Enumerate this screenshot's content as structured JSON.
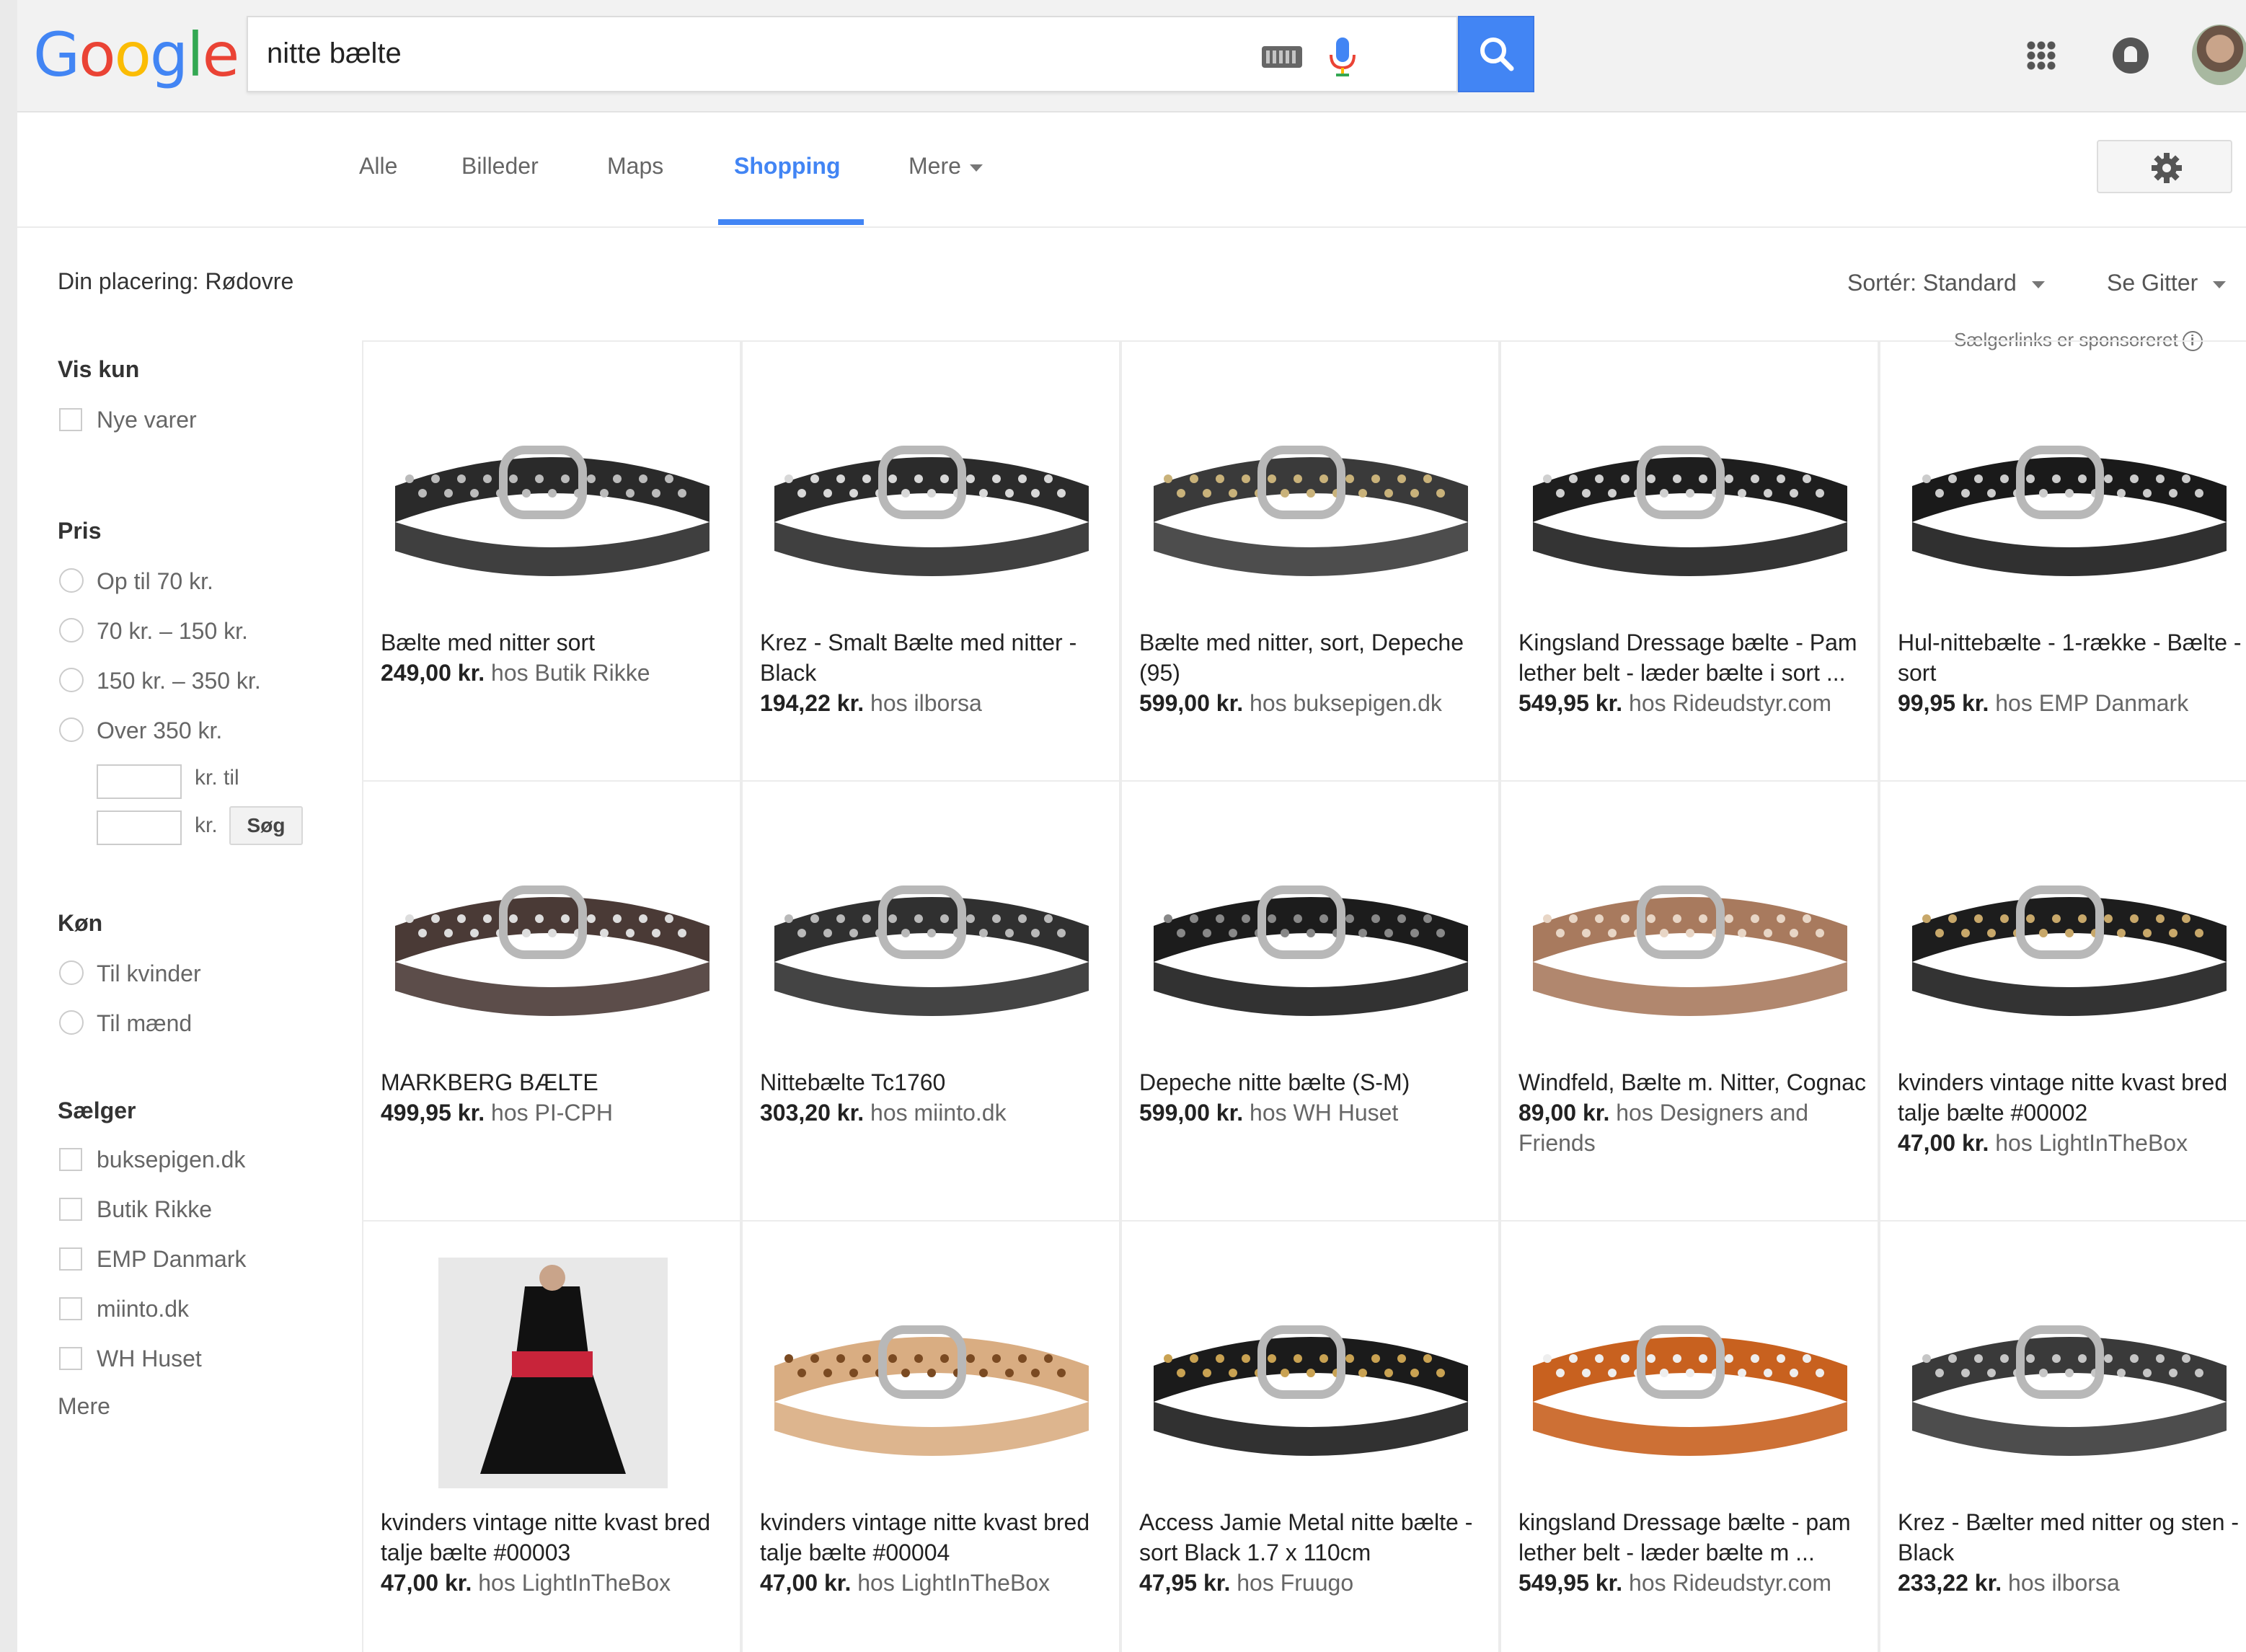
{
  "search": {
    "query": "nitte bælte"
  },
  "logo": {
    "letters": [
      "G",
      "o",
      "o",
      "g",
      "l",
      "e"
    ],
    "colors": [
      "#4285f4",
      "#ea4335",
      "#fbbc05",
      "#4285f4",
      "#34a853",
      "#ea4335"
    ]
  },
  "tabs": [
    {
      "label": "Alle"
    },
    {
      "label": "Billeder"
    },
    {
      "label": "Maps"
    },
    {
      "label": "Shopping",
      "active": true
    },
    {
      "label": "Mere"
    }
  ],
  "location": "Din placering: Rødovre",
  "sort": {
    "label": "Sortér:",
    "value": "Standard",
    "view_label": "Se",
    "view_value": "Gitter"
  },
  "sponsored": "Sælgerlinks er sponsoreret",
  "filters": {
    "vis_kun": {
      "title": "Vis kun",
      "options": [
        "Nye varer"
      ]
    },
    "pris": {
      "title": "Pris",
      "options": [
        "Op til 70 kr.",
        "70 kr. – 150 kr.",
        "150 kr. – 350 kr.",
        "Over 350 kr."
      ],
      "kr_til": "kr. til",
      "kr": "kr.",
      "search_button": "Søg"
    },
    "kon": {
      "title": "Køn",
      "options": [
        "Til kvinder",
        "Til mænd"
      ]
    },
    "saelger": {
      "title": "Sælger",
      "options": [
        "buksepigen.dk",
        "Butik Rikke",
        "EMP Danmark",
        "miinto.dk",
        "WH Huset"
      ],
      "more": "Mere"
    }
  },
  "products": [
    {
      "title": "Bælte med nitter sort",
      "price": "249,00 kr.",
      "seller": "hos Butik Rikke",
      "img": "belt-studded-black"
    },
    {
      "title": "Krez - Smalt Bælte med nitter - Black",
      "price": "194,22 kr.",
      "seller": "hos ilborsa",
      "img": "belt-silver-studs"
    },
    {
      "title": "Bælte med nitter, sort, Depeche (95)",
      "price": "599,00 kr.",
      "seller": "hos buksepigen.dk",
      "img": "belt-straight-studded"
    },
    {
      "title": "Kingsland Dressage bælte - Pam lether belt - læder bælte i sort ...",
      "price": "549,95 kr.",
      "seller": "hos Rideudstyr.com",
      "img": "belt-black-crystals"
    },
    {
      "title": "Hul-nittebælte - 1-række - Bælte - sort",
      "price": "99,95 kr.",
      "seller": "hos EMP Danmark",
      "img": "belt-grommet-black"
    },
    {
      "title": "MARKBERG BÆLTE",
      "price": "499,95 kr.",
      "seller": "hos PI-CPH",
      "img": "belt-brown-studded"
    },
    {
      "title": "Nittebælte Tc1760",
      "price": "303,20 kr.",
      "seller": "hos miinto.dk",
      "img": "belt-dark-studded"
    },
    {
      "title": "Depeche nitte bælte (S-M)",
      "price": "599,00 kr.",
      "seller": "hos WH Huset",
      "img": "belt-black-straight"
    },
    {
      "title": "Windfeld, Bælte m. Nitter, Cognac",
      "price": "89,00 kr.",
      "seller": "hos Designers and Friends",
      "img": "belt-cognac"
    },
    {
      "title": "kvinders vintage nitte kvast bred talje bælte #00002",
      "price": "47,00 kr.",
      "seller": "hos LightInTheBox",
      "img": "belt-wide-black"
    },
    {
      "title": "kvinders vintage nitte kvast bred talje bælte #00003",
      "price": "47,00 kr.",
      "seller": "hos LightInTheBox",
      "img": "dress-red-belt"
    },
    {
      "title": "kvinders vintage nitte kvast bred talje bælte #00004",
      "price": "47,00 kr.",
      "seller": "hos LightInTheBox",
      "img": "belt-wide-tan"
    },
    {
      "title": "Access Jamie Metal nitte bælte - sort Black 1.7 x 110cm",
      "price": "47,95 kr.",
      "seller": "hos Fruugo",
      "img": "belt-grommet-gold"
    },
    {
      "title": "kingsland Dressage bælte - pam lether belt - læder bælte m ...",
      "price": "549,95 kr.",
      "seller": "hos Rideudstyr.com",
      "img": "belt-orange-crystals"
    },
    {
      "title": "Krez - Bælter med nitter og sten - Black",
      "price": "233,22 kr.",
      "seller": "hos ilborsa",
      "img": "belt-gray-studded"
    }
  ]
}
